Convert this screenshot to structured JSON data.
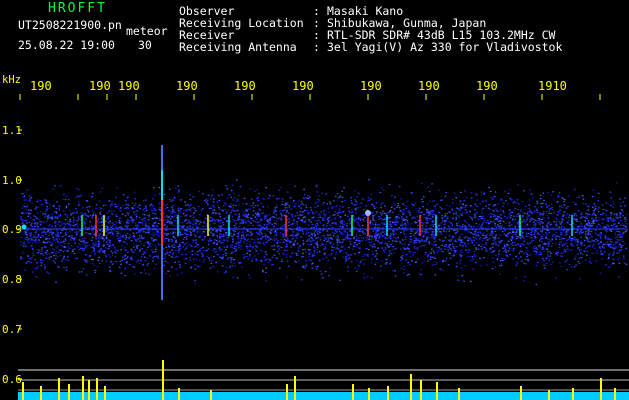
{
  "app_title": "HROFFT",
  "file_name": "UT2508221900.pn",
  "meteor_label": "meteor",
  "date": "25.08.22 19:00",
  "interval": "30",
  "info": [
    {
      "key": "Observer",
      "value": "Masaki Kano"
    },
    {
      "key": "Receiving Location",
      "value": "Shibukawa, Gunma, Japan"
    },
    {
      "key": "Receiver",
      "value": "RTL-SDR SDR# 43dB L15 103.2MHz CW"
    },
    {
      "key": "Receiving Antenna",
      "value": "3el Yagi(V) Az 330 for Vladivostok"
    }
  ],
  "y_unit": "kHz",
  "time_ticks": [
    "190",
    "190",
    "190",
    "190",
    "190",
    "190",
    "190",
    "190",
    "190",
    "1910"
  ],
  "freq_ticks": [
    "1.1",
    "1.0",
    "0.9",
    "0.8",
    "0.7",
    "0.6"
  ],
  "colors": {
    "axis_text": "#ffff00",
    "title_text": "#00ff3c",
    "noise": "#1a2aff",
    "baseline": "#00ccff",
    "peaks": "#ffff00"
  }
}
